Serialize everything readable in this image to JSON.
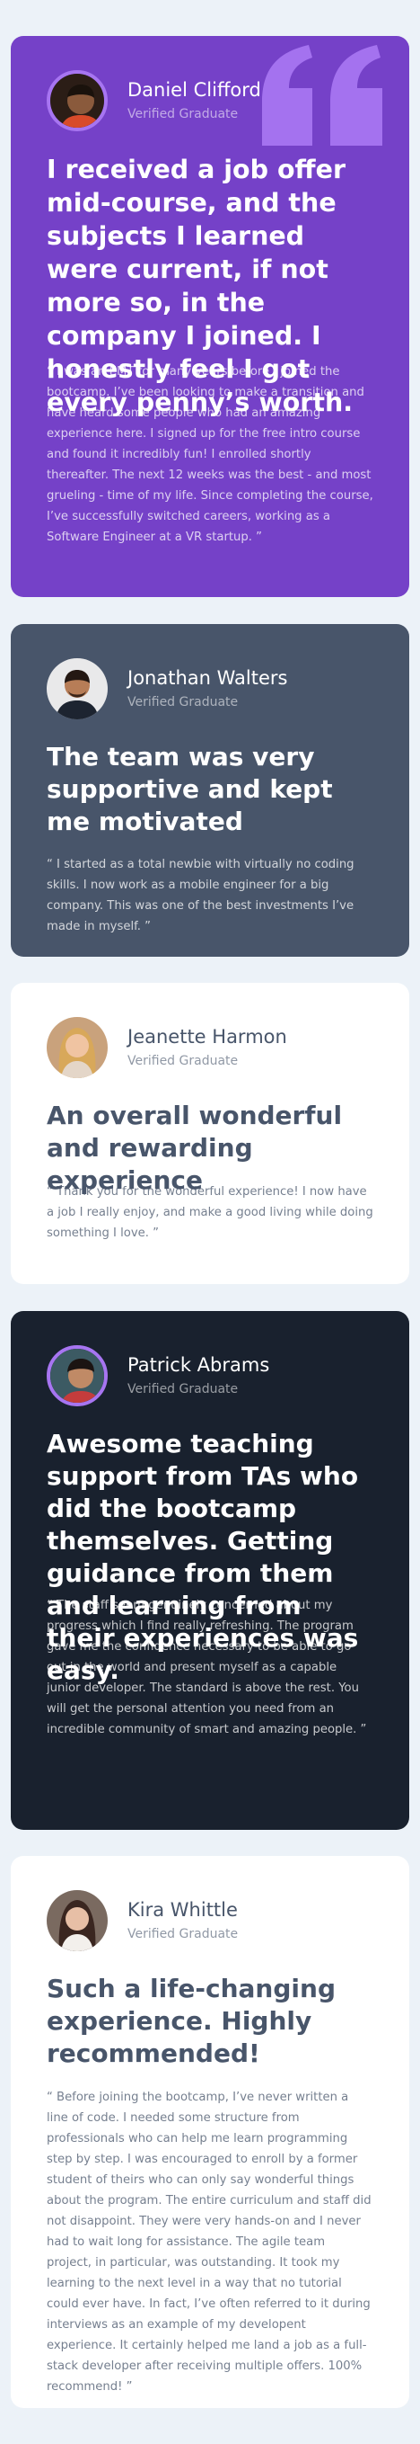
{
  "colors": {
    "background": "#ecf2f8",
    "violet": "#7541c8",
    "slate": "#48556a",
    "white": "#ffffff",
    "dark": "#19212e",
    "accent": "#a775f1"
  },
  "testimonials": [
    {
      "name": "Daniel Clifford",
      "status": "Verified Graduate",
      "headline": "I received a job offer mid-course, and the subjects I learned were current, if not more so, in the company I joined. I honestly feel I got every penny’s worth.",
      "quote": "“ I was an EMT for many years before I joined the bootcamp. I’ve been looking to make a transition and have heard some people who had an amazing experience here. I signed up for the free intro course and found it incredibly fun! I enrolled shortly thereafter. The next 12 weeks was the best - and most grueling - time of my life. Since completing the course, I’ve successfully switched careers, working as a Software Engineer at a VR startup. ”",
      "icon": "quotation-mark-icon"
    },
    {
      "name": "Jonathan Walters",
      "status": "Verified Graduate",
      "headline": "The team was very supportive and kept me motivated",
      "quote": "“ I started as a total newbie with virtually no coding skills. I now work as a mobile engineer for a big company. This was one of the best investments I’ve made in myself. ”"
    },
    {
      "name": "Jeanette Harmon",
      "status": "Verified Graduate",
      "headline": "An overall wonderful and rewarding experience",
      "quote": "“ Thank you for the wonderful experience! I now have a job I really enjoy, and make a good living while doing something I love. ”"
    },
    {
      "name": "Patrick Abrams",
      "status": "Verified Graduate",
      "headline": "Awesome teaching support from TAs who did the bootcamp themselves. Getting guidance from them and learning from their experiences was easy.",
      "quote": "“ The staff seem genuinely concerned about my progress which I find really refreshing. The program gave me the confidence necessary to be able to go out in the world and present myself as a capable junior developer. The standard is above the rest. You will get the personal attention you need from an incredible community of smart and amazing people. ”"
    },
    {
      "name": "Kira Whittle",
      "status": "Verified Graduate",
      "headline": "Such a life-changing experience. Highly recommended!",
      "quote": "“ Before joining the bootcamp, I’ve never written a line of code. I needed some structure from professionals who can help me learn programming step by step. I was encouraged to enroll by a former student of theirs who can only say wonderful things about the program. The entire curriculum and staff did not disappoint. They were very hands-on and I never had to wait long for assistance. The agile team project, in particular, was outstanding. It took my learning to the next level in a way that no tutorial could ever have. In fact, I’ve often referred to it during interviews as an example of my developent experience. It certainly helped me land a job as a full-stack developer after receiving multiple offers. 100% recommend! ”"
    }
  ]
}
